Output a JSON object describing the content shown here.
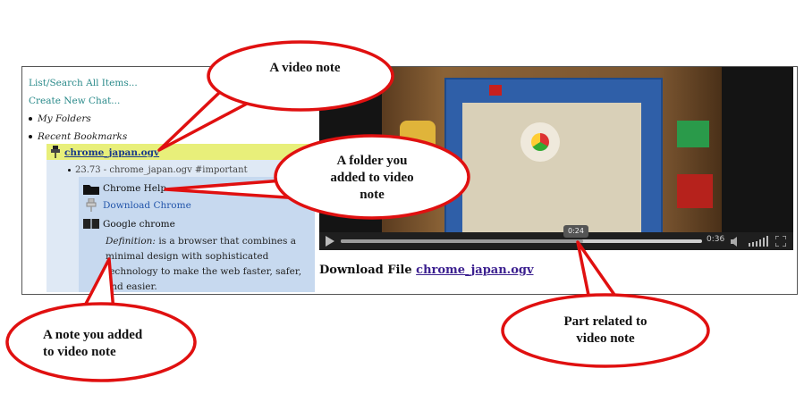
{
  "sidebar": {
    "list_search": "List/Search All Items...",
    "create_chat": "Create New Chat...",
    "my_folders": "My Folders",
    "recent_bookmarks": "Recent Bookmarks",
    "bookmark_title": "chrome_japan.ogv",
    "note_subtitle": "23.73 - chrome_japan.ogv #important",
    "folder_item": "Chrome Help",
    "link_item": "Download Chrome",
    "note_item": "Google chrome",
    "definition_label": "Definition:",
    "definition_text": "is a browser that combines a minimal design with sophisticated technology to make the web faster, safer, and easier."
  },
  "video": {
    "time_tooltip": "0:24",
    "duration": "0:36",
    "progress_fraction": 0.67
  },
  "download": {
    "label": "Download File",
    "filename": "chrome_japan.ogv"
  },
  "callouts": {
    "video_note": "A video note",
    "folder_line1": "A folder you",
    "folder_line2": "added to video",
    "folder_line3": "note",
    "note_line1": "A note you added",
    "note_line2": "to video note",
    "part_line1": "Part related to",
    "part_line2": "video note"
  },
  "colors": {
    "callout_border": "#e01010",
    "bookmark_highlight": "#e8ef7a",
    "note_bg": "#dfe9f5",
    "link": "#2a8a8a"
  }
}
